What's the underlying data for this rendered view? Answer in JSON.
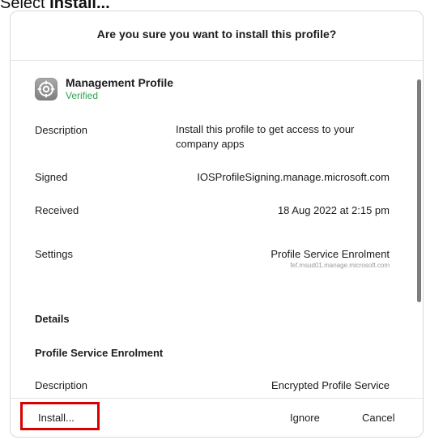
{
  "caption": {
    "prefix": "Select ",
    "emphasis": "Install..."
  },
  "dialog": {
    "title": "Are you sure you want to install this profile?",
    "profile": {
      "name": "Management Profile",
      "status": "Verified",
      "icon": "settings-gear-icon"
    },
    "rows": {
      "description": {
        "label": "Description",
        "value": "Install this profile to get access to your company apps"
      },
      "signed": {
        "label": "Signed",
        "value": "IOSProfileSigning.manage.microsoft.com"
      },
      "received": {
        "label": "Received",
        "value": "18 Aug 2022 at 2:15 pm"
      },
      "settings": {
        "label": "Settings",
        "value": "Profile Service Enrolment",
        "subvalue": "fef.msud01.manage.microsoft.com"
      }
    },
    "details": {
      "heading": "Details",
      "section_title": "Profile Service Enrolment",
      "description_label": "Description",
      "description_value": "Encrypted Profile Service"
    },
    "buttons": {
      "install": "Install...",
      "ignore": "Ignore",
      "cancel": "Cancel"
    }
  },
  "colors": {
    "verified": "#2ea44f",
    "highlight": "#d90000"
  }
}
